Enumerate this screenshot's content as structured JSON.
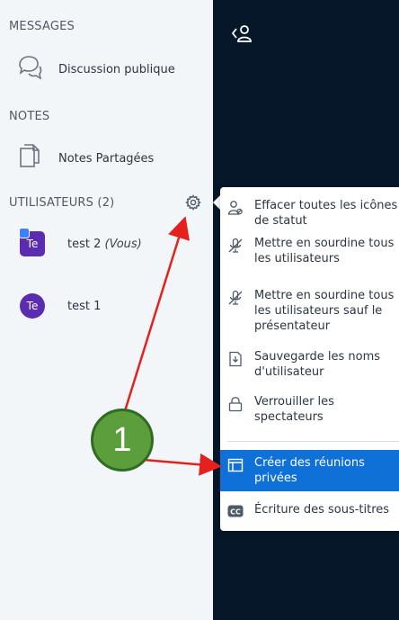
{
  "sidebar": {
    "messages_title": "MESSAGES",
    "public_chat": "Discussion publique",
    "notes_title": "NOTES",
    "shared_notes": "Notes Partagées",
    "users_title": "UTILISATEURS (2)"
  },
  "users": [
    {
      "initials": "Te",
      "name": "test 2",
      "suffix": "(Vous)",
      "presenter": true
    },
    {
      "initials": "Te",
      "name": "test 1",
      "suffix": "",
      "presenter": false
    }
  ],
  "user_menu": {
    "items": [
      {
        "label": "Effacer toutes les icônes de statut",
        "icon": "clear-status-icon"
      },
      {
        "label": "Mettre en sourdine tous les utilisateurs",
        "icon": "mute-icon"
      },
      {
        "label": "Mettre en sourdine tous les utilisateurs sauf le présentateur",
        "icon": "mute-icon"
      },
      {
        "label": "Sauvegarde les noms d'utilisateur",
        "icon": "save-file-icon"
      },
      {
        "label": "Verrouiller les spectateurs",
        "icon": "lock-icon"
      },
      {
        "label": "Créer des réunions privées",
        "icon": "breakout-rooms-icon"
      },
      {
        "label": "Écriture des sous-titres",
        "icon": "closed-captions-icon"
      }
    ]
  },
  "annotation": {
    "number": "1"
  },
  "colors": {
    "sidebar_bg": "#f3f6f9",
    "main_bg": "#06172a",
    "active_item": "#0f70d7",
    "avatar": "#5b2bb0",
    "callout": "#5c9e3c",
    "arrow": "#e5211d"
  }
}
